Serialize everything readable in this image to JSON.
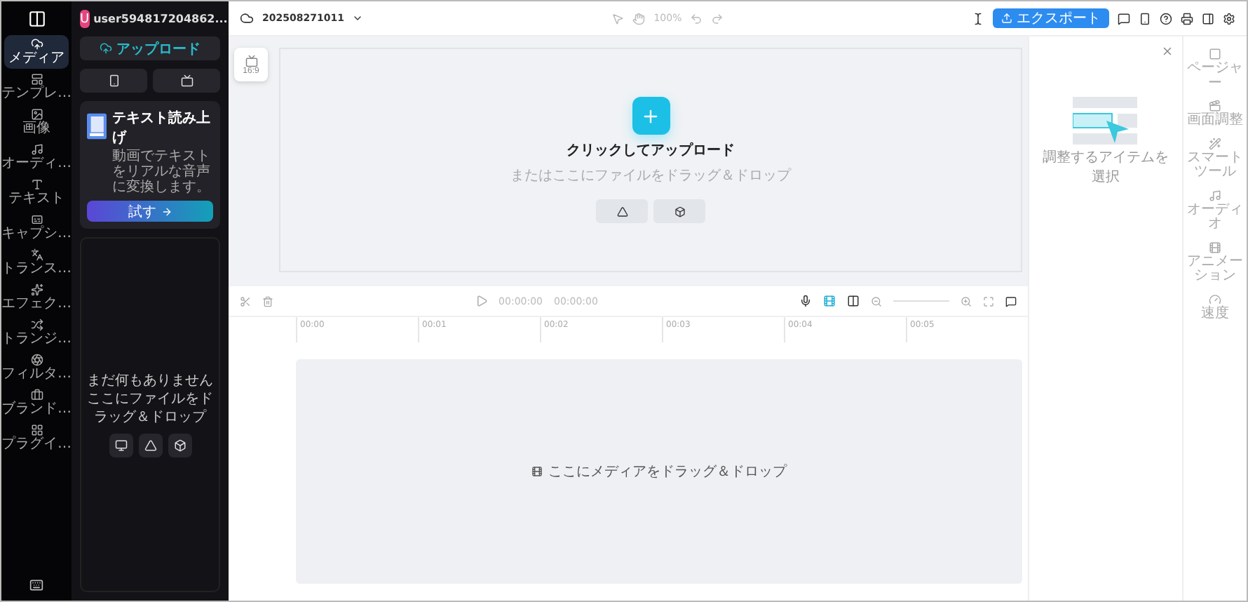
{
  "user": {
    "initial": "U",
    "name": "user594817204862..."
  },
  "rail": [
    {
      "label": "メディア",
      "selected": true
    },
    {
      "label": "テンプレ…",
      "selected": false
    },
    {
      "label": "画像",
      "selected": false
    },
    {
      "label": "オーディ…",
      "selected": false
    },
    {
      "label": "テキスト",
      "selected": false
    },
    {
      "label": "キャプシ…",
      "selected": false
    },
    {
      "label": "トランス…",
      "selected": false
    },
    {
      "label": "エフェク…",
      "selected": false
    },
    {
      "label": "トランジ…",
      "selected": false
    },
    {
      "label": "フィルタ…",
      "selected": false
    },
    {
      "label": "ブランド…",
      "selected": false
    },
    {
      "label": "プラグイ…",
      "selected": false
    }
  ],
  "panel": {
    "upload": "アップロード",
    "tts": {
      "title": "テキスト読み上げ",
      "description": "動画でテキストをリアルな音声に変換します。",
      "button": "試す"
    },
    "empty": {
      "title": "まだ何もありません",
      "hint": "ここにファイルをドラッグ＆ドロップ"
    }
  },
  "topbar": {
    "project": "202508271011",
    "zoom": "100%",
    "export": "エクスポート"
  },
  "stage": {
    "aspect": "16:9",
    "title": "クリックしてアップロード",
    "hint": "またはここにファイルをドラッグ＆ドロップ"
  },
  "inspector": {
    "hint": "調整するアイテムを選択"
  },
  "right_rail": [
    "ページャー",
    "画面調整",
    "スマートツール",
    "オーディオ",
    "アニメーション",
    "速度"
  ],
  "timeline": {
    "current": "00:00:00",
    "duration": "00:00:00",
    "ticks": [
      "00:00",
      "00:01",
      "00:02",
      "00:03",
      "00:04",
      "00:05"
    ],
    "drop": "ここにメディアをドラッグ＆ドロップ"
  }
}
